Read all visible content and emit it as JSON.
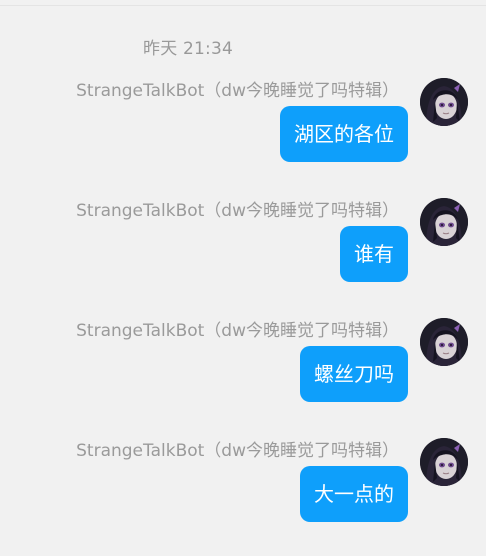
{
  "timestamp": "昨天 21:34",
  "messages": [
    {
      "sender": "StrangeTalkBot（dw今晚睡觉了吗特辑）",
      "text": "湖区的各位",
      "avatar": "anime-avatar-icon"
    },
    {
      "sender": "StrangeTalkBot（dw今晚睡觉了吗特辑）",
      "text": "谁有",
      "avatar": "anime-avatar-icon"
    },
    {
      "sender": "StrangeTalkBot（dw今晚睡觉了吗特辑）",
      "text": "螺丝刀吗",
      "avatar": "anime-avatar-icon"
    },
    {
      "sender": "StrangeTalkBot（dw今晚睡觉了吗特辑）",
      "text": "大一点的",
      "avatar": "anime-avatar-icon"
    }
  ],
  "colors": {
    "background": "#f1f1f1",
    "bubble": "#0e9ffb",
    "bubble_text": "#ffffff",
    "meta_text": "#999999"
  }
}
